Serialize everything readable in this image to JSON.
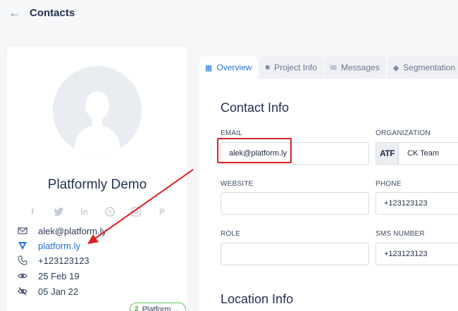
{
  "header": {
    "title": "Contacts",
    "back_icon": "arrow-left-icon"
  },
  "profile": {
    "name": "Platformly Demo",
    "email": "alek@platform.ly",
    "website": "platform.ly",
    "phone": "+123123123",
    "created": "25 Feb 19",
    "last_seen": "05 Jan 22",
    "badge_count": "2",
    "badge_label": "Platform....",
    "socials": [
      "facebook-icon",
      "twitter-icon",
      "linkedin-icon",
      "skype-icon",
      "instagram-icon",
      "pinterest-icon"
    ]
  },
  "tabs": [
    {
      "label": "Overview",
      "icon": "grid-icon",
      "active": true
    },
    {
      "label": "Project Info",
      "icon": "folder-icon",
      "active": false
    },
    {
      "label": "Messages",
      "icon": "envelope-icon",
      "active": false
    },
    {
      "label": "Segmentation",
      "icon": "tag-icon",
      "active": false
    }
  ],
  "contact_info": {
    "title": "Contact Info",
    "email_label": "EMAIL",
    "email_value": "alek@platform.ly",
    "organization_label": "ORGANIZATION",
    "organization_logo": "ATF",
    "organization_value": "CK Team",
    "website_label": "WEBSITE",
    "website_value": "",
    "phone_label": "PHONE",
    "phone_value": "+123123123",
    "role_label": "ROLE",
    "role_value": "",
    "sms_label": "SMS NUMBER",
    "sms_value": "+123123123"
  },
  "location_info": {
    "title": "Location Info"
  },
  "colors": {
    "accent": "#1f74d6",
    "annotation": "#e02020",
    "badge_border": "#5cbf5c"
  }
}
